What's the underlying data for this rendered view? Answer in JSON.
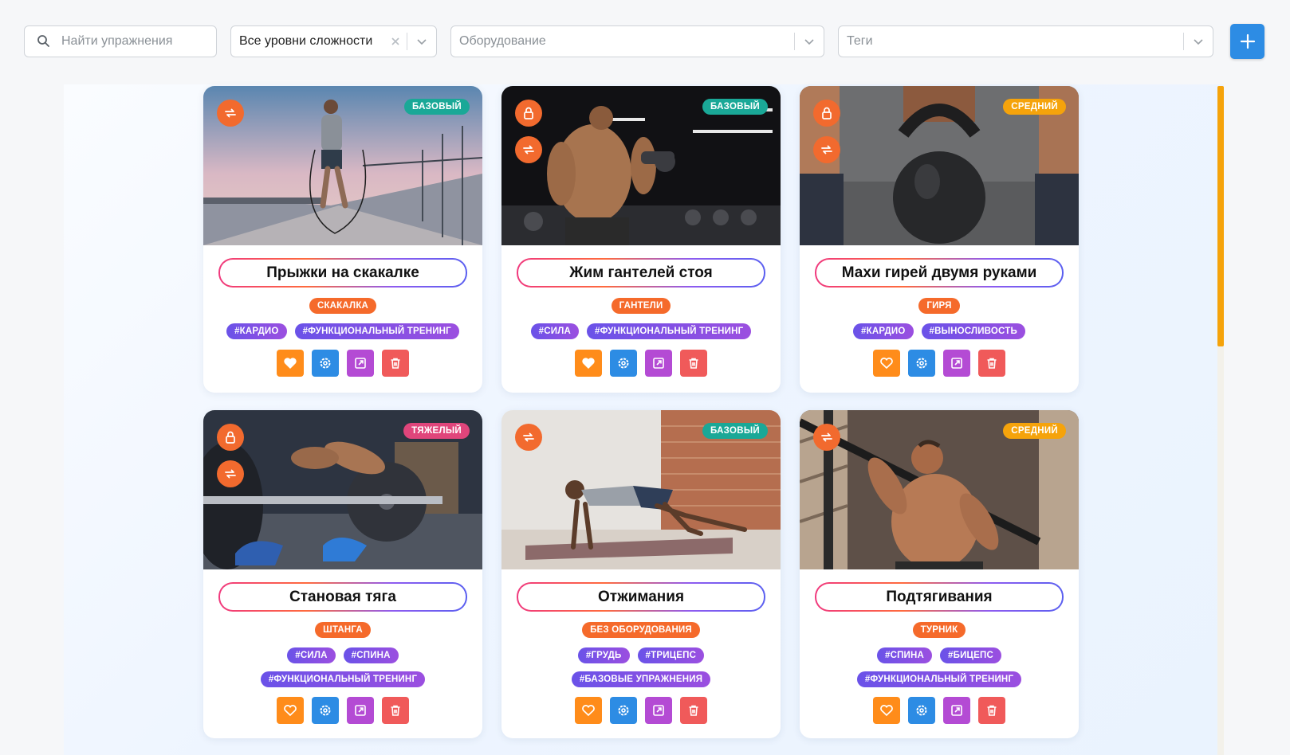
{
  "toolbar": {
    "search_placeholder": "Найти упражнения",
    "difficulty_value": "Все уровни сложности",
    "equipment_placeholder": "Оборудование",
    "tags_placeholder": "Теги",
    "add_label": "+"
  },
  "colors": {
    "accent_blue": "#2d8ce4",
    "orange": "#f56a2b",
    "level_base": "#1aa897",
    "level_mid": "#f5a30b",
    "level_hard": "#e0457b",
    "tag_purple": "#7a51e6",
    "fav": "#ff8c1a",
    "open": "#b44bd4",
    "delete": "#f05a5a"
  },
  "cards": [
    {
      "title": "Прыжки на скакалке",
      "level": "БАЗОВЫЙ",
      "equipment": "СКАКАЛКА",
      "tags_row1": [
        "#КАРДИО",
        "#ФУНКЦИОНАЛЬНЫЙ ТРЕНИНГ"
      ],
      "tags_row2": [],
      "icons": [
        "repeat-icon"
      ],
      "photo": "man jumping rope on a bridge at dusk"
    },
    {
      "title": "Жим гантелей стоя",
      "level": "БАЗОВЫЙ",
      "equipment": "ГАНТЕЛИ",
      "tags_row1": [
        "#СИЛА",
        "#ФУНКЦИОНАЛЬНЫЙ ТРЕНИНГ"
      ],
      "tags_row2": [],
      "icons": [
        "lock-icon",
        "repeat-icon"
      ],
      "photo": "muscular man curling dumbbell in dark gym"
    },
    {
      "title": "Махи гирей двумя руками",
      "level": "СРЕДНИЙ",
      "equipment": "ГИРЯ",
      "tags_row1": [
        "#КАРДИО",
        "#ВЫНОСЛИВОСТЬ"
      ],
      "tags_row2": [],
      "icons": [
        "lock-icon",
        "repeat-icon"
      ],
      "photo": "hand lifting 16kg kettlebell"
    },
    {
      "title": "Становая тяга",
      "level": "ТЯЖЕЛЫЙ",
      "equipment": "ШТАНГА",
      "tags_row1": [
        "#СИЛА",
        "#СПИНА"
      ],
      "tags_row2": [
        "#ФУНКЦИОНАЛЬНЫЙ ТРЕНИНГ"
      ],
      "icons": [
        "lock-icon",
        "repeat-icon"
      ],
      "photo": "athlete chalking hands over barbell"
    },
    {
      "title": "Отжимания",
      "level": "БАЗОВЫЙ",
      "equipment": "БЕЗ ОБОРУДОВАНИЯ",
      "tags_row1": [
        "#ГРУДЬ",
        "#ТРИЦЕПС"
      ],
      "tags_row2": [
        "#БАЗОВЫЕ УПРАЖНЕНИЯ"
      ],
      "icons": [
        "repeat-icon"
      ],
      "photo": "man doing mountain climbers on mat"
    },
    {
      "title": "Подтягивания",
      "level": "СРЕДНИЙ",
      "equipment": "ТУРНИК",
      "tags_row1": [
        "#СПИНА",
        "#БИЦЕПС"
      ],
      "tags_row2": [
        "#ФУНКЦИОНАЛЬНЫЙ ТРЕНИНГ"
      ],
      "icons": [
        "repeat-icon"
      ],
      "photo": "shirtless man doing pull-ups"
    }
  ]
}
